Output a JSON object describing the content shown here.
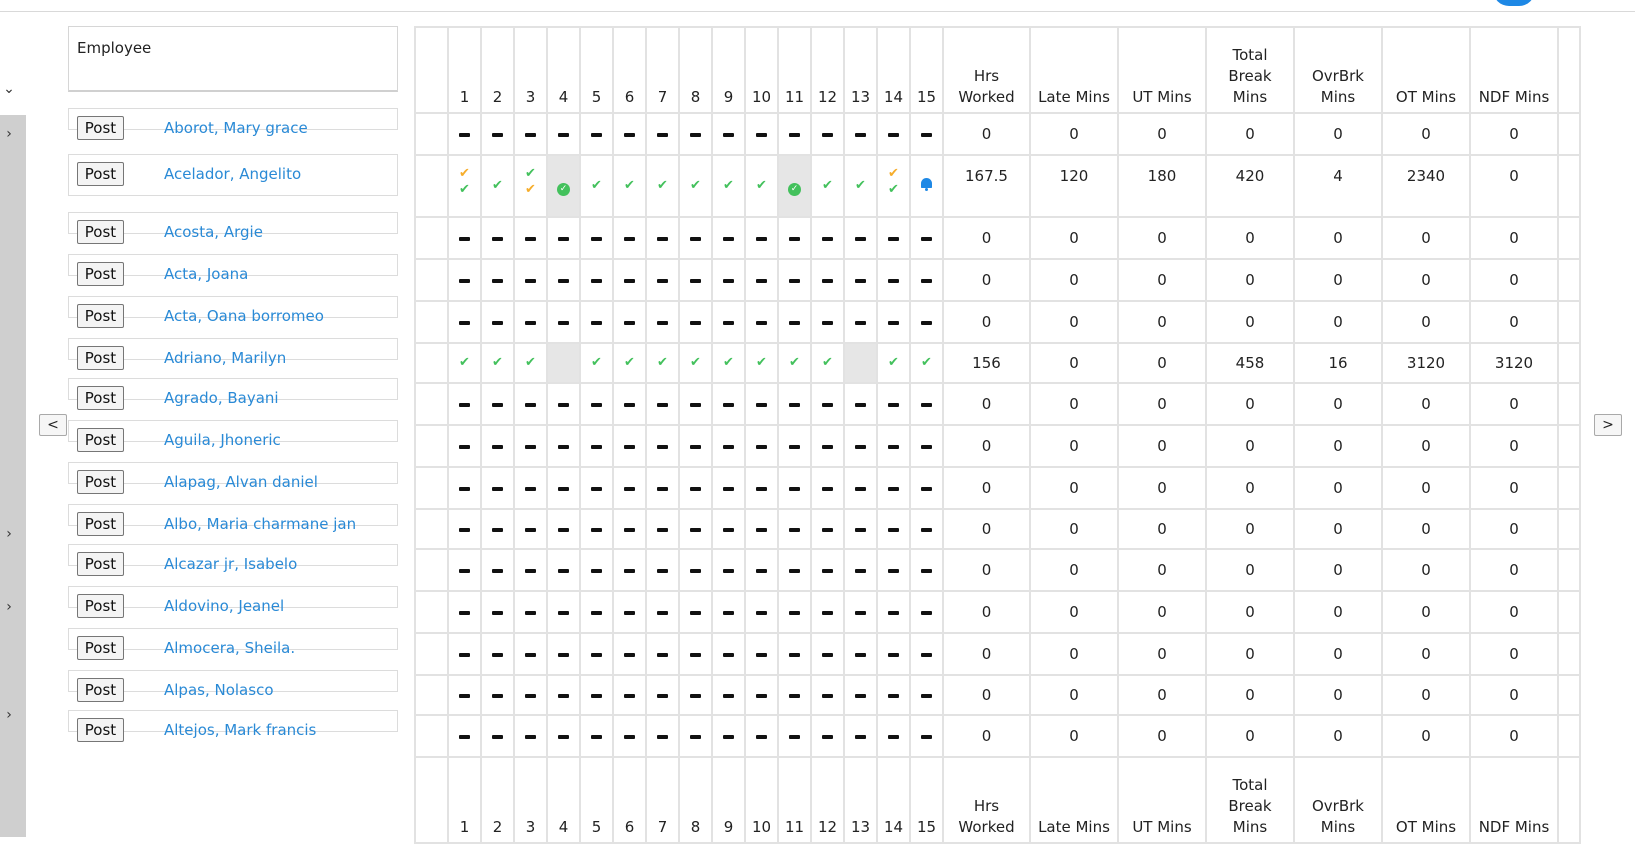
{
  "header": {
    "employee_label": "Employee"
  },
  "columns": {
    "days": [
      "1",
      "2",
      "3",
      "4",
      "5",
      "6",
      "7",
      "8",
      "9",
      "10",
      "11",
      "12",
      "13",
      "14",
      "15"
    ],
    "hrs_worked": [
      "Hrs",
      "Worked"
    ],
    "late_mins": [
      "Late Mins"
    ],
    "ut_mins": [
      "UT Mins"
    ],
    "total_break": [
      "Total",
      "Break",
      "Mins"
    ],
    "ovrbrk": [
      "OvrBrk",
      "Mins"
    ],
    "ot_mins": [
      "OT Mins"
    ],
    "ndf_mins": [
      "NDF Mins"
    ]
  },
  "post_label": "Post",
  "nav": {
    "prev": "<",
    "next": ">"
  },
  "rows": [
    {
      "name": "Aborot, Mary grace",
      "days": [
        "-",
        "-",
        "-",
        "-",
        "-",
        "-",
        "-",
        "-",
        "-",
        "-",
        "-",
        "-",
        "-",
        "-",
        "-"
      ],
      "hrs": "0",
      "late": "0",
      "ut": "0",
      "brk": "0",
      "ovr": "0",
      "ot": "0",
      "ndf": "0"
    },
    {
      "name": "Acelador, Angelito",
      "days": [
        "oc,gc",
        "gc",
        "gc,oc",
        "circ",
        "gc",
        "gc",
        "gc",
        "gc",
        "gc",
        "gc",
        "circ",
        "gc",
        "gc",
        "oc,gc",
        "bell"
      ],
      "gray": [
        4,
        11
      ],
      "hrs": "167.5",
      "late": "120",
      "ut": "180",
      "brk": "420",
      "ovr": "4",
      "ot": "2340",
      "ndf": "0"
    },
    {
      "name": "Acosta, Argie",
      "days": [
        "-",
        "-",
        "-",
        "-",
        "-",
        "-",
        "-",
        "-",
        "-",
        "-",
        "-",
        "-",
        "-",
        "-",
        "-"
      ],
      "hrs": "0",
      "late": "0",
      "ut": "0",
      "brk": "0",
      "ovr": "0",
      "ot": "0",
      "ndf": "0"
    },
    {
      "name": "Acta, Joana",
      "days": [
        "-",
        "-",
        "-",
        "-",
        "-",
        "-",
        "-",
        "-",
        "-",
        "-",
        "-",
        "-",
        "-",
        "-",
        "-"
      ],
      "hrs": "0",
      "late": "0",
      "ut": "0",
      "brk": "0",
      "ovr": "0",
      "ot": "0",
      "ndf": "0"
    },
    {
      "name": "Acta, Oana borromeo",
      "days": [
        "-",
        "-",
        "-",
        "-",
        "-",
        "-",
        "-",
        "-",
        "-",
        "-",
        "-",
        "-",
        "-",
        "-",
        "-"
      ],
      "hrs": "0",
      "late": "0",
      "ut": "0",
      "brk": "0",
      "ovr": "0",
      "ot": "0",
      "ndf": "0"
    },
    {
      "name": "Adriano, Marilyn",
      "days": [
        "gc",
        "gc",
        "gc",
        "",
        "gc",
        "gc",
        "gc",
        "gc",
        "gc",
        "gc",
        "gc",
        "gc",
        "",
        "gc",
        "gc"
      ],
      "gray": [
        4,
        13
      ],
      "hrs": "156",
      "late": "0",
      "ut": "0",
      "brk": "458",
      "ovr": "16",
      "ot": "3120",
      "ndf": "3120"
    },
    {
      "name": "Agrado, Bayani",
      "days": [
        "-",
        "-",
        "-",
        "-",
        "-",
        "-",
        "-",
        "-",
        "-",
        "-",
        "-",
        "-",
        "-",
        "-",
        "-"
      ],
      "hrs": "0",
      "late": "0",
      "ut": "0",
      "brk": "0",
      "ovr": "0",
      "ot": "0",
      "ndf": "0"
    },
    {
      "name": "Aguila, Jhoneric",
      "days": [
        "-",
        "-",
        "-",
        "-",
        "-",
        "-",
        "-",
        "-",
        "-",
        "-",
        "-",
        "-",
        "-",
        "-",
        "-"
      ],
      "hrs": "0",
      "late": "0",
      "ut": "0",
      "brk": "0",
      "ovr": "0",
      "ot": "0",
      "ndf": "0"
    },
    {
      "name": "Alapag, Alvan daniel",
      "days": [
        "-",
        "-",
        "-",
        "-",
        "-",
        "-",
        "-",
        "-",
        "-",
        "-",
        "-",
        "-",
        "-",
        "-",
        "-"
      ],
      "hrs": "0",
      "late": "0",
      "ut": "0",
      "brk": "0",
      "ovr": "0",
      "ot": "0",
      "ndf": "0"
    },
    {
      "name": "Albo, Maria charmane jan",
      "days": [
        "-",
        "-",
        "-",
        "-",
        "-",
        "-",
        "-",
        "-",
        "-",
        "-",
        "-",
        "-",
        "-",
        "-",
        "-"
      ],
      "hrs": "0",
      "late": "0",
      "ut": "0",
      "brk": "0",
      "ovr": "0",
      "ot": "0",
      "ndf": "0"
    },
    {
      "name": "Alcazar jr, Isabelo",
      "days": [
        "-",
        "-",
        "-",
        "-",
        "-",
        "-",
        "-",
        "-",
        "-",
        "-",
        "-",
        "-",
        "-",
        "-",
        "-"
      ],
      "hrs": "0",
      "late": "0",
      "ut": "0",
      "brk": "0",
      "ovr": "0",
      "ot": "0",
      "ndf": "0"
    },
    {
      "name": "Aldovino, Jeanel",
      "days": [
        "-",
        "-",
        "-",
        "-",
        "-",
        "-",
        "-",
        "-",
        "-",
        "-",
        "-",
        "-",
        "-",
        "-",
        "-"
      ],
      "hrs": "0",
      "late": "0",
      "ut": "0",
      "brk": "0",
      "ovr": "0",
      "ot": "0",
      "ndf": "0"
    },
    {
      "name": "Almocera, Sheila.",
      "days": [
        "-",
        "-",
        "-",
        "-",
        "-",
        "-",
        "-",
        "-",
        "-",
        "-",
        "-",
        "-",
        "-",
        "-",
        "-"
      ],
      "hrs": "0",
      "late": "0",
      "ut": "0",
      "brk": "0",
      "ovr": "0",
      "ot": "0",
      "ndf": "0"
    },
    {
      "name": "Alpas, Nolasco",
      "days": [
        "-",
        "-",
        "-",
        "-",
        "-",
        "-",
        "-",
        "-",
        "-",
        "-",
        "-",
        "-",
        "-",
        "-",
        "-"
      ],
      "hrs": "0",
      "late": "0",
      "ut": "0",
      "brk": "0",
      "ovr": "0",
      "ot": "0",
      "ndf": "0"
    },
    {
      "name": "Altejos, Mark francis",
      "days": [
        "-",
        "-",
        "-",
        "-",
        "-",
        "-",
        "-",
        "-",
        "-",
        "-",
        "-",
        "-",
        "-",
        "-",
        "-"
      ],
      "hrs": "0",
      "late": "0",
      "ut": "0",
      "brk": "0",
      "ovr": "0",
      "ot": "0",
      "ndf": "0"
    }
  ],
  "icons": {
    "check_green": "#43c15c",
    "check_orange": "#f6ad2b",
    "bell": "#1e88e5",
    "link_color": "#2a8ad6"
  }
}
